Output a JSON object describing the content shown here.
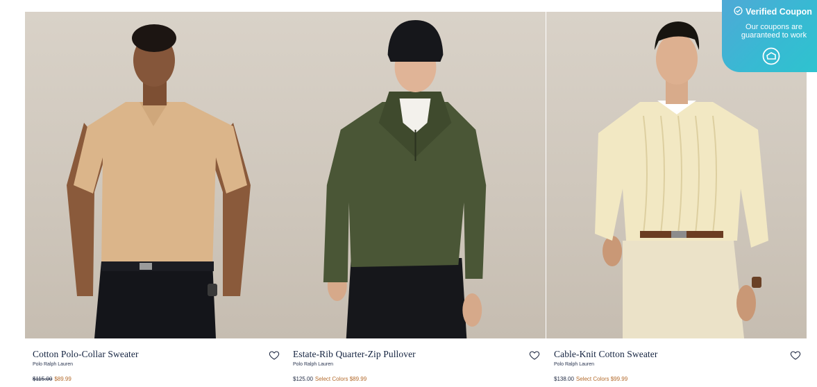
{
  "products": [
    {
      "title": "Cotton Polo-Collar Sweater",
      "brand": "Polo Ralph Lauren",
      "price_original": "$115.00",
      "price_sale": "$89.99",
      "price_regular": "",
      "select_colors": ""
    },
    {
      "title": "Estate-Rib Quarter-Zip Pullover",
      "brand": "Polo Ralph Lauren",
      "price_original": "",
      "price_sale": "Select Colors $89.99",
      "price_regular": "$125.00",
      "select_colors": ""
    },
    {
      "title": "Cable-Knit Cotton Sweater",
      "brand": "Polo Ralph Lauren",
      "price_original": "",
      "price_sale": "Select Colors $99.99",
      "price_regular": "$138.00",
      "select_colors": ""
    }
  ],
  "coupon": {
    "title": "Verified Coupon",
    "subtitle": "Our coupons are guaranteed to work"
  },
  "colors": {
    "accent_sale": "#b36a2b",
    "title_navy": "#13223f",
    "coupon_bg": "#3ab5d4"
  },
  "icons": [
    "heart-icon",
    "check-circle-icon",
    "coupon-logo-icon"
  ]
}
